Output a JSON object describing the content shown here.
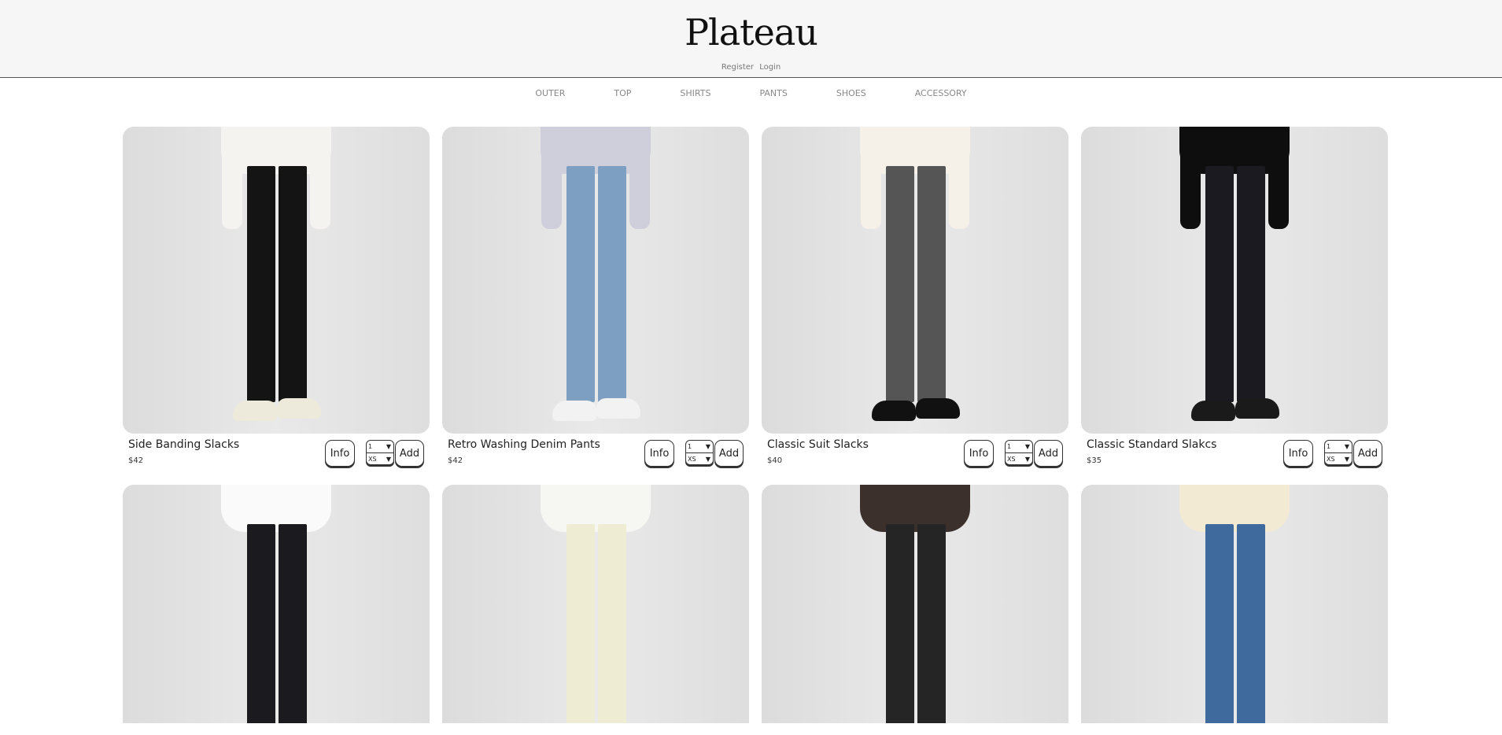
{
  "header": {
    "logo": "Plateau",
    "register": "Register",
    "login": "Login"
  },
  "nav": [
    "OUTER",
    "TOP",
    "SHIRTS",
    "PANTS",
    "SHOES",
    "ACCESSORY"
  ],
  "colors": {
    "header_bg": "#f6f6f6",
    "photo_bg": "#e2e2e2"
  },
  "products": [
    {
      "name": "Side Banding Slacks",
      "price": "$42",
      "qty": "1",
      "size": "XS",
      "info": "Info",
      "add": "Add",
      "top": "#f4f3ef",
      "pants": "#141414",
      "shoes": "#eeeadb"
    },
    {
      "name": "Retro Washing Denim Pants",
      "price": "$42",
      "qty": "1",
      "size": "XS",
      "info": "Info",
      "add": "Add",
      "top": "#cfcfdc",
      "pants": "#7d9fc2",
      "shoes": "#f2f2f2"
    },
    {
      "name": "Classic Suit Slacks",
      "price": "$40",
      "qty": "1",
      "size": "XS",
      "info": "Info",
      "add": "Add",
      "top": "#f5f1e8",
      "pants": "#555555",
      "shoes": "#111111"
    },
    {
      "name": "Classic Standard Slakcs",
      "price": "$35",
      "qty": "1",
      "size": "XS",
      "info": "Info",
      "add": "Add",
      "top": "#0e0e0e",
      "pants": "#1a1a20",
      "shoes": "#1a1a1a"
    }
  ],
  "products_row2": [
    {
      "top": "#fafafa",
      "pants": "#1b1b1f"
    },
    {
      "top": "#f6f6f3",
      "pants": "#efecd4"
    },
    {
      "top": "#3b302c",
      "pants": "#252525"
    },
    {
      "top": "#f2ead2",
      "pants": "#3f6a9e"
    }
  ]
}
